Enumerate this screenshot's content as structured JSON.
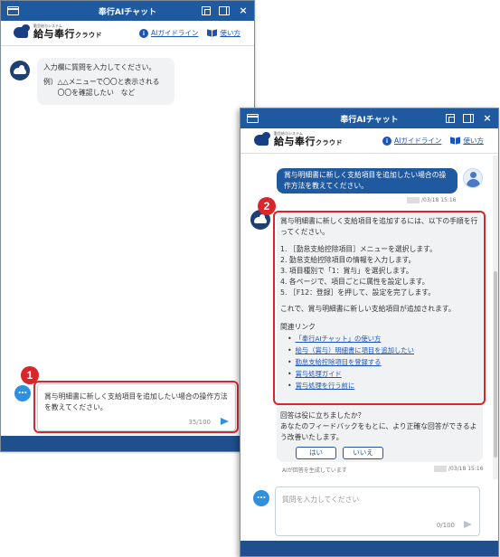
{
  "window": {
    "title": "奉行AIチャット"
  },
  "brand": {
    "logo_sub": "勤怠給与システム",
    "logo_main": "給与奉行",
    "logo_suffix": "クラウド",
    "guideline_link": "AIガイドライン",
    "howto_link": "使い方"
  },
  "window1": {
    "welcome": {
      "line1": "入力欄に質問を入力してください。",
      "example_label": "例）",
      "example_line1": "△△メニューで〇〇と表示される",
      "example_line2": "〇〇を確認したい　など"
    },
    "input": {
      "value": "賞与明細書に新しく支給項目を追加したい場合の操作方法を教えてください。",
      "counter": "35/100"
    },
    "callout_badge": "1"
  },
  "window2": {
    "user_message": "賞与明細書に新しく支給項目を追加したい場合の操作方法を教えてください。",
    "user_timestamp": "/03/18 15:16",
    "answer": {
      "intro": "賞与明細書に新しく支給項目を追加するには、以下の手順を行ってください。",
      "steps": [
        "1. ［勤怠支給控除項目］メニューを選択します。",
        "2. 勤怠支給控除項目の情報を入力します。",
        "3. 項目種別で「1：賞与」を選択します。",
        "4. 各ページで、項目ごとに属性を設定します。",
        "5. ［F12：登録］を押して、設定を完了します。"
      ],
      "conclusion": "これで、賞与明細書に新しい支給項目が追加されます。",
      "related_title": "関連リンク",
      "related_links": [
        "「奉行AIチャット」の使い方",
        "給与（賞与）明細書に項目を追加したい",
        "勤怠支給控除項目を登録する",
        "賞与処理ガイド",
        "賞与処理を行う前に"
      ]
    },
    "feedback": {
      "question": "回答は役に立ちましたか？",
      "note": "あなたのフィードバックをもとに、より正確な回答ができるよう改善いたします。",
      "yes": "はい",
      "no": "いいえ"
    },
    "ai_note": "AIが回答を生成しています",
    "bot_timestamp": "/03/18 15:16",
    "input": {
      "placeholder": "質問を入力してください",
      "counter": "0/100"
    },
    "callout_badge": "2"
  },
  "colors": {
    "title_bar": "#1f5aa0",
    "footer": "#1f4f8c",
    "user_bubble": "#1f5aa0",
    "link": "#1a55b5",
    "callout": "#d8262a"
  },
  "icons": [
    "app-window-icon",
    "popout-icon",
    "sidebar-icon",
    "close-icon",
    "info-icon",
    "book-icon",
    "bot-avatar-icon",
    "user-avatar-icon",
    "chat-bubble-icon",
    "send-icon"
  ]
}
